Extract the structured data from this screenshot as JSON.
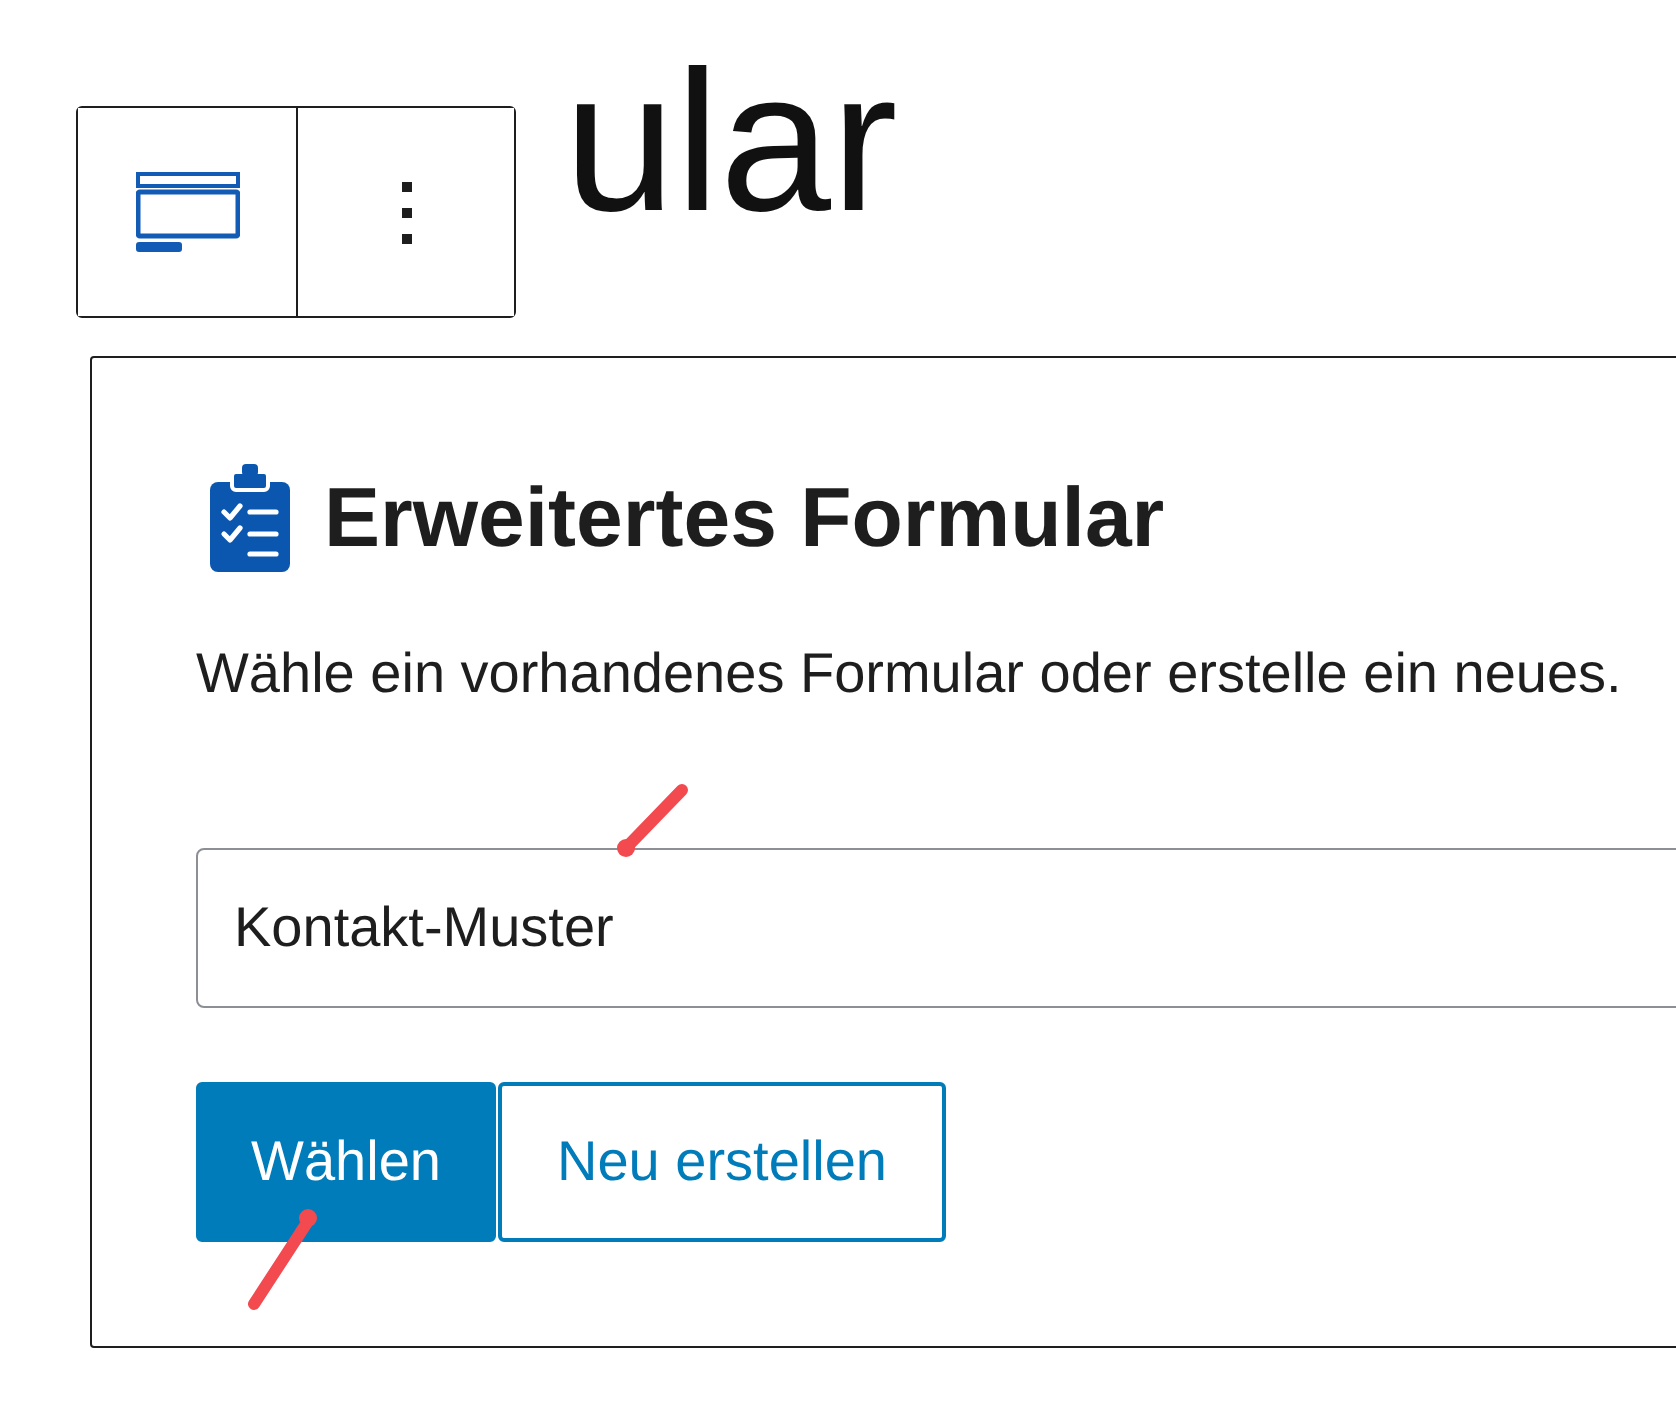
{
  "page_title": "ular",
  "form_block": {
    "title": "Erweitertes Formular",
    "description": "Wähle ein vorhandenes Formular oder erstelle ein neues.",
    "form_field": {
      "value": "Kontakt-Muster"
    },
    "buttons": [
      {
        "label": "Wählen",
        "kind": "primary"
      },
      {
        "label": "Neu erstellen",
        "kind": "secondary"
      }
    ]
  }
}
